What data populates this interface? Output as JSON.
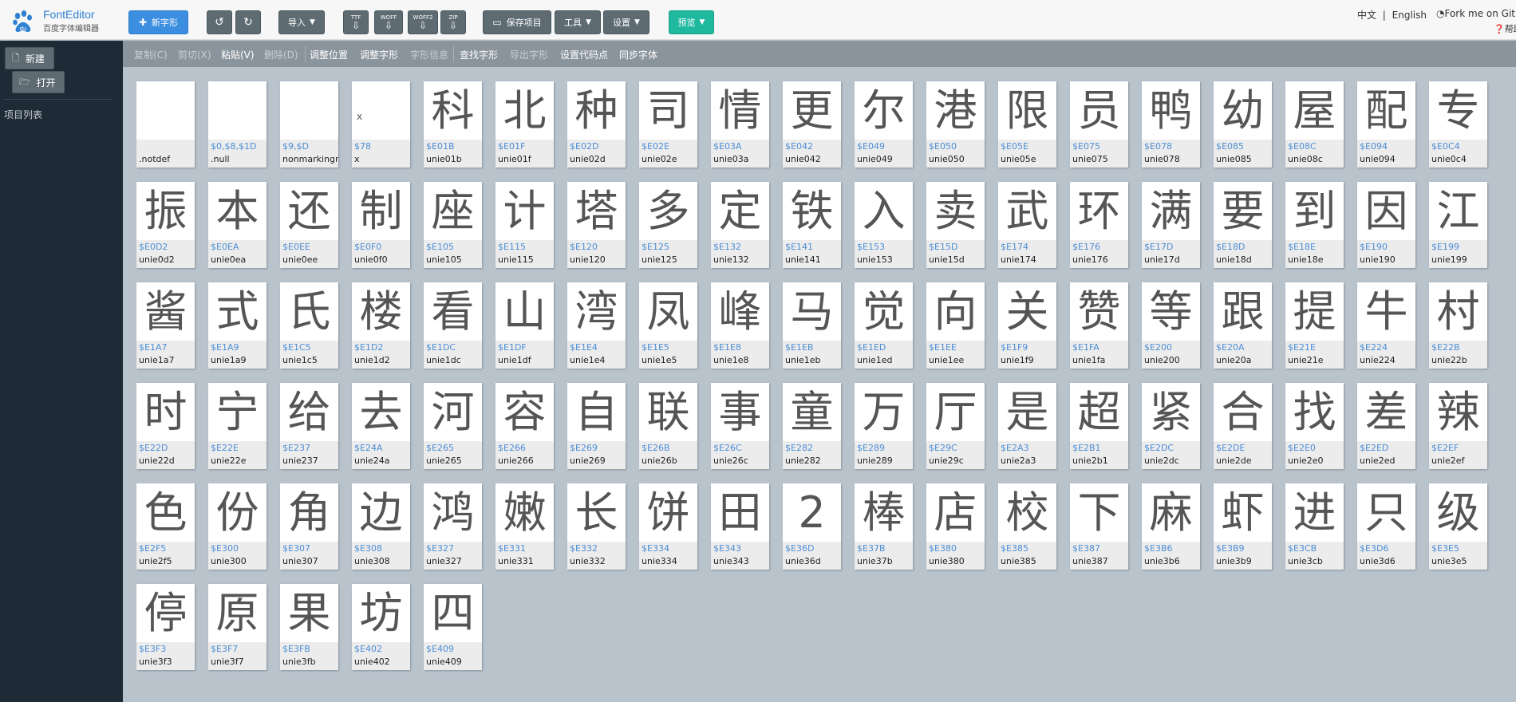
{
  "brand": {
    "title": "FontEditor",
    "subtitle": "百度字体编辑器",
    "logo_icon": "baidu-paw-icon"
  },
  "toolbar": {
    "new_glyph": "新字形",
    "import": "导入",
    "ttf": "TTF",
    "woff": "WOFF",
    "woff2": "WOFF2",
    "zip": "ZIP",
    "save_project": "保存项目",
    "tools": "工具",
    "settings": "设置",
    "preview": "预览"
  },
  "header_right": {
    "lang_zh": "中文",
    "lang_sep": "|",
    "lang_en": "English",
    "fork": "Fork me on Github",
    "help": "帮助"
  },
  "sidebar": {
    "new": "新建",
    "open": "打开",
    "project_list": "项目列表"
  },
  "subbar": {
    "copy": "复制(C)",
    "cut": "剪切(X)",
    "paste": "粘贴(V)",
    "delete": "删除(D)",
    "adjust_pos": "调整位置",
    "adjust_glyph": "调整字形",
    "glyph_info": "字形信息",
    "find_glyph": "查找字形",
    "export_glyph": "导出字形",
    "set_codepoint": "设置代码点",
    "sync_font": "同步字体"
  },
  "glyphs": [
    {
      "char": "",
      "code": "",
      "name": ".notdef"
    },
    {
      "char": "",
      "code": "$0,$8,$1D",
      "name": ".null"
    },
    {
      "char": "",
      "code": "$9,$D",
      "name": "nonmarkingreturn"
    },
    {
      "char": "x",
      "code": "$78",
      "name": "x"
    },
    {
      "char": "科",
      "code": "$E01B",
      "name": "unie01b"
    },
    {
      "char": "北",
      "code": "$E01F",
      "name": "unie01f"
    },
    {
      "char": "种",
      "code": "$E02D",
      "name": "unie02d"
    },
    {
      "char": "司",
      "code": "$E02E",
      "name": "unie02e"
    },
    {
      "char": "情",
      "code": "$E03A",
      "name": "unie03a"
    },
    {
      "char": "更",
      "code": "$E042",
      "name": "unie042"
    },
    {
      "char": "尔",
      "code": "$E049",
      "name": "unie049"
    },
    {
      "char": "港",
      "code": "$E050",
      "name": "unie050"
    },
    {
      "char": "限",
      "code": "$E05E",
      "name": "unie05e"
    },
    {
      "char": "员",
      "code": "$E075",
      "name": "unie075"
    },
    {
      "char": "鸭",
      "code": "$E078",
      "name": "unie078"
    },
    {
      "char": "幼",
      "code": "$E085",
      "name": "unie085"
    },
    {
      "char": "屋",
      "code": "$E08C",
      "name": "unie08c"
    },
    {
      "char": "配",
      "code": "$E094",
      "name": "unie094"
    },
    {
      "char": "专",
      "code": "$E0C4",
      "name": "unie0c4"
    },
    {
      "char": "振",
      "code": "$E0D2",
      "name": "unie0d2"
    },
    {
      "char": "本",
      "code": "$E0EA",
      "name": "unie0ea"
    },
    {
      "char": "还",
      "code": "$E0EE",
      "name": "unie0ee"
    },
    {
      "char": "制",
      "code": "$E0F0",
      "name": "unie0f0"
    },
    {
      "char": "座",
      "code": "$E105",
      "name": "unie105"
    },
    {
      "char": "计",
      "code": "$E115",
      "name": "unie115"
    },
    {
      "char": "塔",
      "code": "$E120",
      "name": "unie120"
    },
    {
      "char": "多",
      "code": "$E125",
      "name": "unie125"
    },
    {
      "char": "定",
      "code": "$E132",
      "name": "unie132"
    },
    {
      "char": "铁",
      "code": "$E141",
      "name": "unie141"
    },
    {
      "char": "入",
      "code": "$E153",
      "name": "unie153"
    },
    {
      "char": "卖",
      "code": "$E15D",
      "name": "unie15d"
    },
    {
      "char": "武",
      "code": "$E174",
      "name": "unie174"
    },
    {
      "char": "环",
      "code": "$E176",
      "name": "unie176"
    },
    {
      "char": "满",
      "code": "$E17D",
      "name": "unie17d"
    },
    {
      "char": "要",
      "code": "$E18D",
      "name": "unie18d"
    },
    {
      "char": "到",
      "code": "$E18E",
      "name": "unie18e"
    },
    {
      "char": "因",
      "code": "$E190",
      "name": "unie190"
    },
    {
      "char": "江",
      "code": "$E199",
      "name": "unie199"
    },
    {
      "char": "酱",
      "code": "$E1A7",
      "name": "unie1a7"
    },
    {
      "char": "式",
      "code": "$E1A9",
      "name": "unie1a9"
    },
    {
      "char": "氏",
      "code": "$E1C5",
      "name": "unie1c5"
    },
    {
      "char": "楼",
      "code": "$E1D2",
      "name": "unie1d2"
    },
    {
      "char": "看",
      "code": "$E1DC",
      "name": "unie1dc"
    },
    {
      "char": "山",
      "code": "$E1DF",
      "name": "unie1df"
    },
    {
      "char": "湾",
      "code": "$E1E4",
      "name": "unie1e4"
    },
    {
      "char": "凤",
      "code": "$E1E5",
      "name": "unie1e5"
    },
    {
      "char": "峰",
      "code": "$E1E8",
      "name": "unie1e8"
    },
    {
      "char": "马",
      "code": "$E1EB",
      "name": "unie1eb"
    },
    {
      "char": "觉",
      "code": "$E1ED",
      "name": "unie1ed"
    },
    {
      "char": "向",
      "code": "$E1EE",
      "name": "unie1ee"
    },
    {
      "char": "关",
      "code": "$E1F9",
      "name": "unie1f9"
    },
    {
      "char": "赞",
      "code": "$E1FA",
      "name": "unie1fa"
    },
    {
      "char": "等",
      "code": "$E200",
      "name": "unie200"
    },
    {
      "char": "跟",
      "code": "$E20A",
      "name": "unie20a"
    },
    {
      "char": "提",
      "code": "$E21E",
      "name": "unie21e"
    },
    {
      "char": "牛",
      "code": "$E224",
      "name": "unie224"
    },
    {
      "char": "村",
      "code": "$E22B",
      "name": "unie22b"
    },
    {
      "char": "时",
      "code": "$E22D",
      "name": "unie22d"
    },
    {
      "char": "宁",
      "code": "$E22E",
      "name": "unie22e"
    },
    {
      "char": "给",
      "code": "$E237",
      "name": "unie237"
    },
    {
      "char": "去",
      "code": "$E24A",
      "name": "unie24a"
    },
    {
      "char": "河",
      "code": "$E265",
      "name": "unie265"
    },
    {
      "char": "容",
      "code": "$E266",
      "name": "unie266"
    },
    {
      "char": "自",
      "code": "$E269",
      "name": "unie269"
    },
    {
      "char": "联",
      "code": "$E26B",
      "name": "unie26b"
    },
    {
      "char": "事",
      "code": "$E26C",
      "name": "unie26c"
    },
    {
      "char": "童",
      "code": "$E282",
      "name": "unie282"
    },
    {
      "char": "万",
      "code": "$E289",
      "name": "unie289"
    },
    {
      "char": "厅",
      "code": "$E29C",
      "name": "unie29c"
    },
    {
      "char": "是",
      "code": "$E2A3",
      "name": "unie2a3"
    },
    {
      "char": "超",
      "code": "$E2B1",
      "name": "unie2b1"
    },
    {
      "char": "紧",
      "code": "$E2DC",
      "name": "unie2dc"
    },
    {
      "char": "合",
      "code": "$E2DE",
      "name": "unie2de"
    },
    {
      "char": "找",
      "code": "$E2E0",
      "name": "unie2e0"
    },
    {
      "char": "差",
      "code": "$E2ED",
      "name": "unie2ed"
    },
    {
      "char": "辣",
      "code": "$E2EF",
      "name": "unie2ef"
    },
    {
      "char": "色",
      "code": "$E2F5",
      "name": "unie2f5"
    },
    {
      "char": "份",
      "code": "$E300",
      "name": "unie300"
    },
    {
      "char": "角",
      "code": "$E307",
      "name": "unie307"
    },
    {
      "char": "边",
      "code": "$E308",
      "name": "unie308"
    },
    {
      "char": "鸿",
      "code": "$E327",
      "name": "unie327"
    },
    {
      "char": "嫩",
      "code": "$E331",
      "name": "unie331"
    },
    {
      "char": "长",
      "code": "$E332",
      "name": "unie332"
    },
    {
      "char": "饼",
      "code": "$E334",
      "name": "unie334"
    },
    {
      "char": "田",
      "code": "$E343",
      "name": "unie343"
    },
    {
      "char": "2",
      "code": "$E36D",
      "name": "unie36d"
    },
    {
      "char": "棒",
      "code": "$E37B",
      "name": "unie37b"
    },
    {
      "char": "店",
      "code": "$E380",
      "name": "unie380"
    },
    {
      "char": "校",
      "code": "$E385",
      "name": "unie385"
    },
    {
      "char": "下",
      "code": "$E387",
      "name": "unie387"
    },
    {
      "char": "麻",
      "code": "$E3B6",
      "name": "unie3b6"
    },
    {
      "char": "虾",
      "code": "$E3B9",
      "name": "unie3b9"
    },
    {
      "char": "进",
      "code": "$E3CB",
      "name": "unie3cb"
    },
    {
      "char": "只",
      "code": "$E3D6",
      "name": "unie3d6"
    },
    {
      "char": "级",
      "code": "$E3E5",
      "name": "unie3e5"
    },
    {
      "char": "停",
      "code": "$E3F3",
      "name": "unie3f3"
    },
    {
      "char": "原",
      "code": "$E3F7",
      "name": "unie3f7"
    },
    {
      "char": "果",
      "code": "$E3FB",
      "name": "unie3fb"
    },
    {
      "char": "坊",
      "code": "$E402",
      "name": "unie402"
    },
    {
      "char": "四",
      "code": "$E409",
      "name": "unie409"
    }
  ]
}
